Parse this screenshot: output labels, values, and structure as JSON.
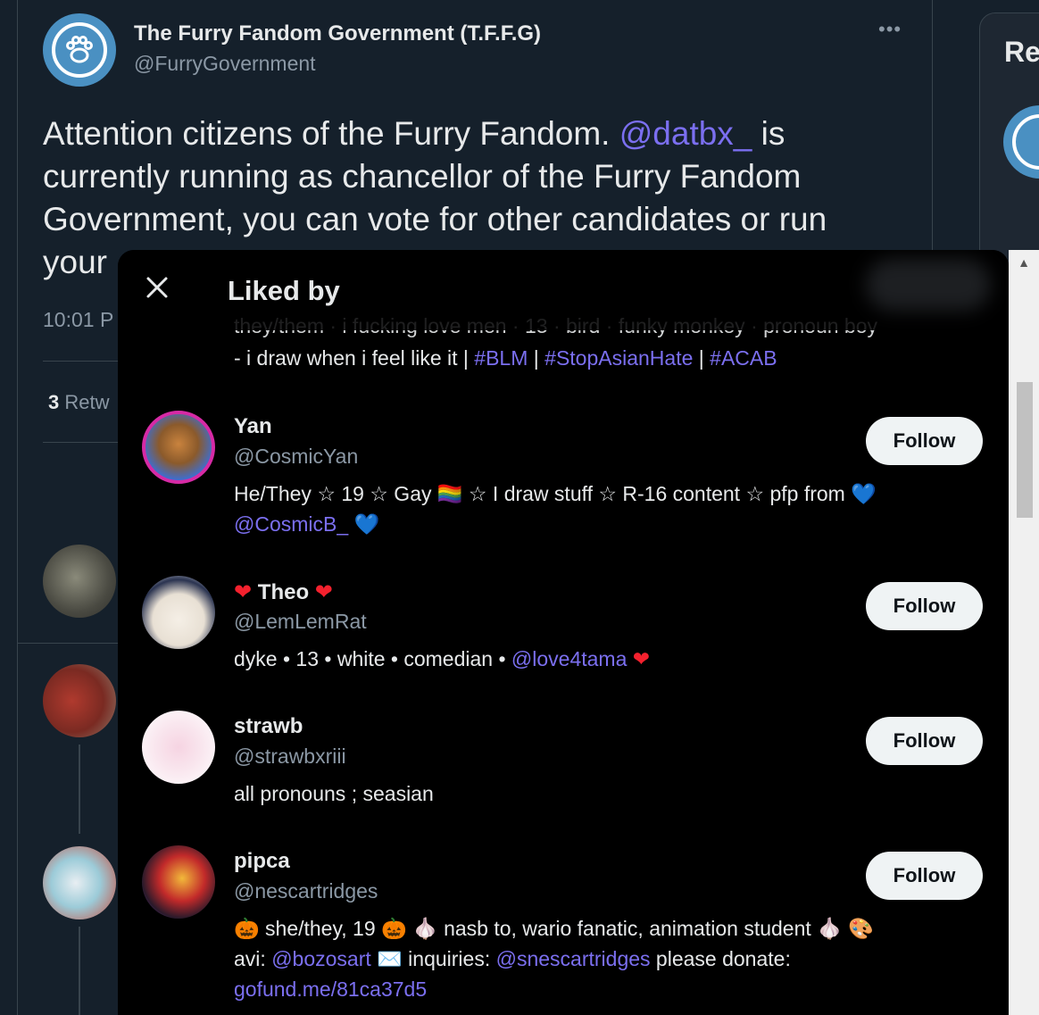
{
  "tweet": {
    "author_name": "The Furry Fandom Government (T.F.F.G)",
    "author_handle": "@FurryGovernment",
    "more": "•••",
    "text_before": "Attention citizens of the Furry Fandom. ",
    "mention": "@datbx_",
    "text_after": " is currently running as chancellor of the Furry Fandom Government, you can vote for other candidates or run your",
    "time": "10:01 P",
    "retweet_count": "3",
    "retweet_label": " Retw"
  },
  "sidebar": {
    "title": "Re"
  },
  "modal": {
    "title": "Liked by",
    "partial_bio_top": "they/them · i fucking love men · 13 · bird · funky monkey · pronoun boy",
    "partial_bio_line2_text": "- i draw when i feel like it | ",
    "partial_bio_tags": [
      "#BLM",
      "#StopAsianHate",
      "#ACAB"
    ],
    "follow_label": "Follow",
    "users": [
      {
        "name": "Yan",
        "handle": "@CosmicYan",
        "bio_1": "He/They ☆ 19 ☆ Gay 🏳️‍🌈 ☆ I draw stuff ☆ R-16 content ☆ pfp from ",
        "bio_heart": "💙",
        "bio_2_mention": "@CosmicB_"
      },
      {
        "name_pre": "❤",
        "name": "Theo",
        "name_post": "❤",
        "handle": "@LemLemRat",
        "bio_1": "dyke • 13 • white • comedian • ",
        "bio_mention": "@love4tama",
        "bio_heart": "❤"
      },
      {
        "name": "strawb",
        "handle": "@strawbxriii",
        "bio_1": "all pronouns ; seasian"
      },
      {
        "name": "pipca",
        "handle": "@nescartridges",
        "bio_1": "🎃 she/they, 19 🎃 🧄 nasb to, wario fanatic, animation student 🧄 🎨",
        "bio_2a": "avi: ",
        "bio_2_mention": "@bozosart",
        "bio_2b": " ✉️ inquiries: ",
        "bio_2_mention2": "@snescartridges",
        "bio_2c": " please donate:",
        "bio_3_link": "gofund.me/81ca37d5"
      }
    ]
  },
  "colors": {
    "bg": "#15202b",
    "modal_bg": "#000000",
    "accent": "#7b6ff0",
    "muted": "#8b98a5"
  }
}
